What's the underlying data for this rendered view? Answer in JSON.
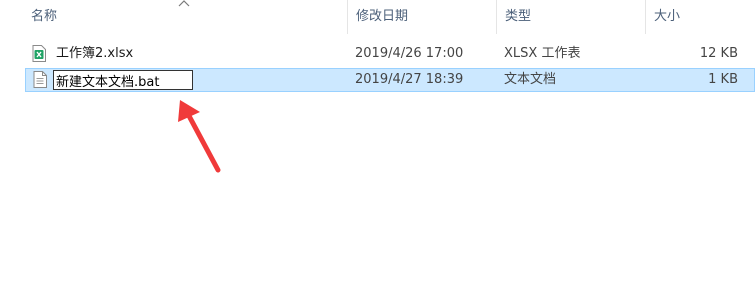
{
  "columns": {
    "name": "名称",
    "date": "修改日期",
    "type": "类型",
    "size": "大小"
  },
  "files": [
    {
      "name": "工作簿2.xlsx",
      "date": "2019/4/26 17:00",
      "type": "XLSX 工作表",
      "size": "12 KB",
      "icon": "excel-file-icon"
    },
    {
      "name": "新建文本文档.bat",
      "date": "2019/4/27 18:39",
      "type": "文本文档",
      "size": "1 KB",
      "icon": "text-file-icon"
    }
  ],
  "colors": {
    "selection": "#cce8ff",
    "selection_border": "#99d1ff",
    "annotation_arrow": "#f03a3a",
    "excel_green": "#21a366"
  }
}
